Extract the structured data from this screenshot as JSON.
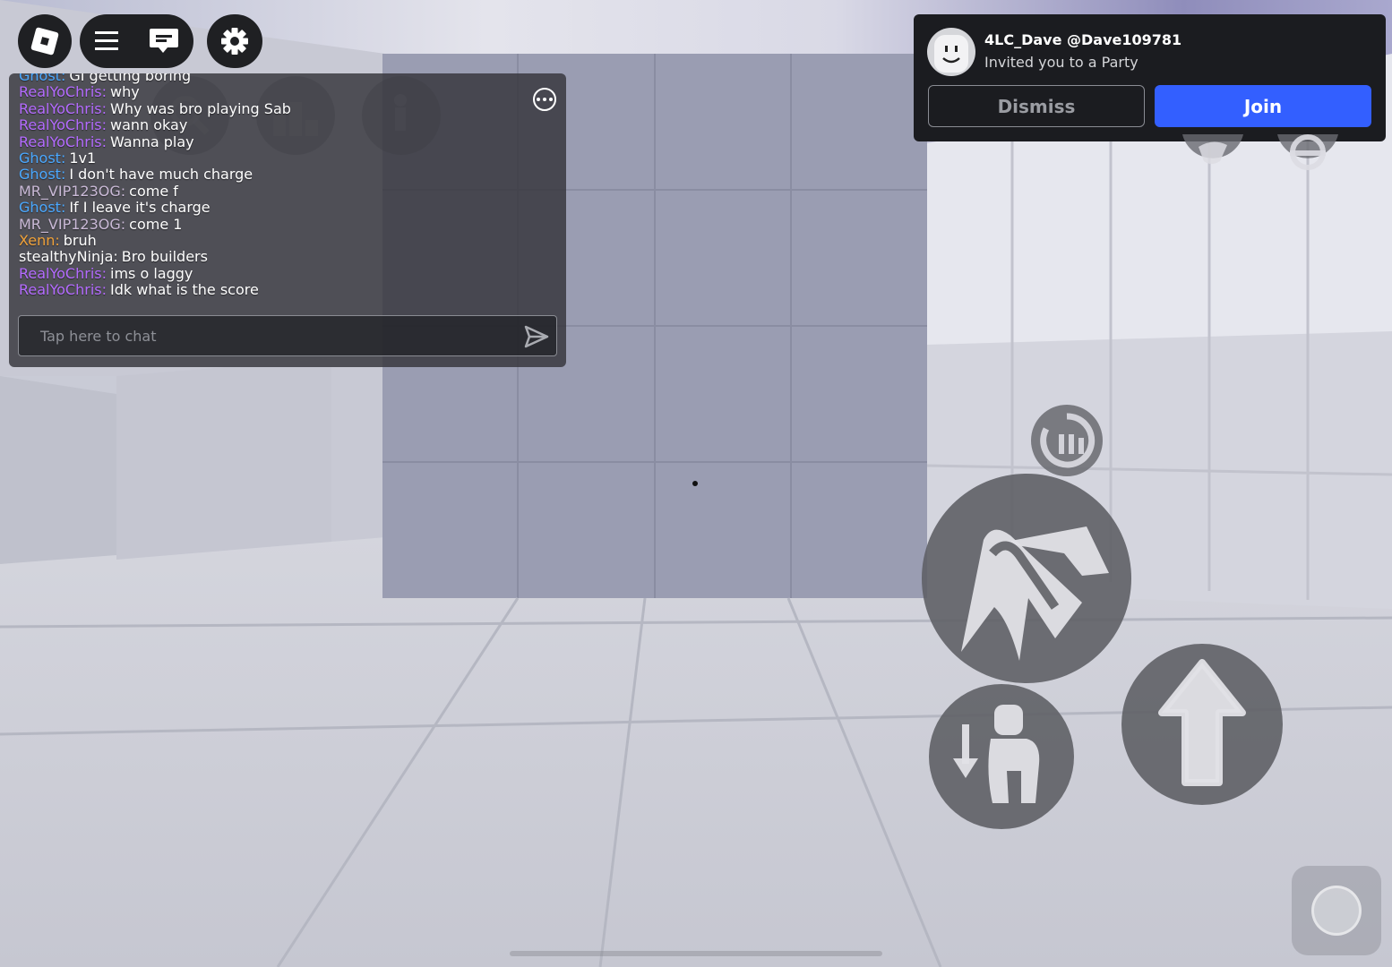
{
  "hud": {
    "roblox_logo_icon": "roblox-logo-icon",
    "menu_icon": "hamburger-menu-icon",
    "chat_icon": "chat-bubble-icon",
    "settings_icon": "gear-icon"
  },
  "chat": {
    "messages": [
      {
        "name": "Ghost:",
        "color": "#4aa8ff",
        "text": "GI getting boring"
      },
      {
        "name": "RealYoChris:",
        "color": "#b46bff",
        "text": "why"
      },
      {
        "name": "RealYoChris:",
        "color": "#b46bff",
        "text": "Why was bro playing Sab"
      },
      {
        "name": "RealYoChris:",
        "color": "#b46bff",
        "text": "wann okay"
      },
      {
        "name": "RealYoChris:",
        "color": "#b46bff",
        "text": "Wanna play"
      },
      {
        "name": "Ghost:",
        "color": "#4aa8ff",
        "text": "1v1"
      },
      {
        "name": "Ghost:",
        "color": "#4aa8ff",
        "text": "I don't have much charge"
      },
      {
        "name": "MR_VIP123OG:",
        "color": "#c9b9d6",
        "text": "come f"
      },
      {
        "name": "Ghost:",
        "color": "#4aa8ff",
        "text": "If I leave it's charge"
      },
      {
        "name": "MR_VIP123OG:",
        "color": "#c9b9d6",
        "text": "come 1"
      },
      {
        "name": "Xenn:",
        "color": "#f0a23a",
        "text": "bruh"
      },
      {
        "name": "stealthyNinja:",
        "color": "#ffffff",
        "text": "Bro builders"
      },
      {
        "name": "RealYoChris:",
        "color": "#b46bff",
        "text": "ims o laggy"
      },
      {
        "name": "RealYoChris:",
        "color": "#b46bff",
        "text": "Idk what is the score"
      }
    ],
    "input_placeholder": "Tap here to chat"
  },
  "invite": {
    "name": "4LC_Dave @Dave109781",
    "subtitle": "Invited you to a Party",
    "dismiss_label": "Dismiss",
    "join_label": "Join",
    "join_color": "#335fff"
  },
  "controls": {
    "ability_icons": [
      "search-icon",
      "leaderboard-icon",
      "emote-icon",
      "punch-ability-icon",
      "block-ability-icon",
      "dash-ability-icon",
      "main-attack-icon",
      "crouch-icon",
      "jump-icon"
    ]
  }
}
